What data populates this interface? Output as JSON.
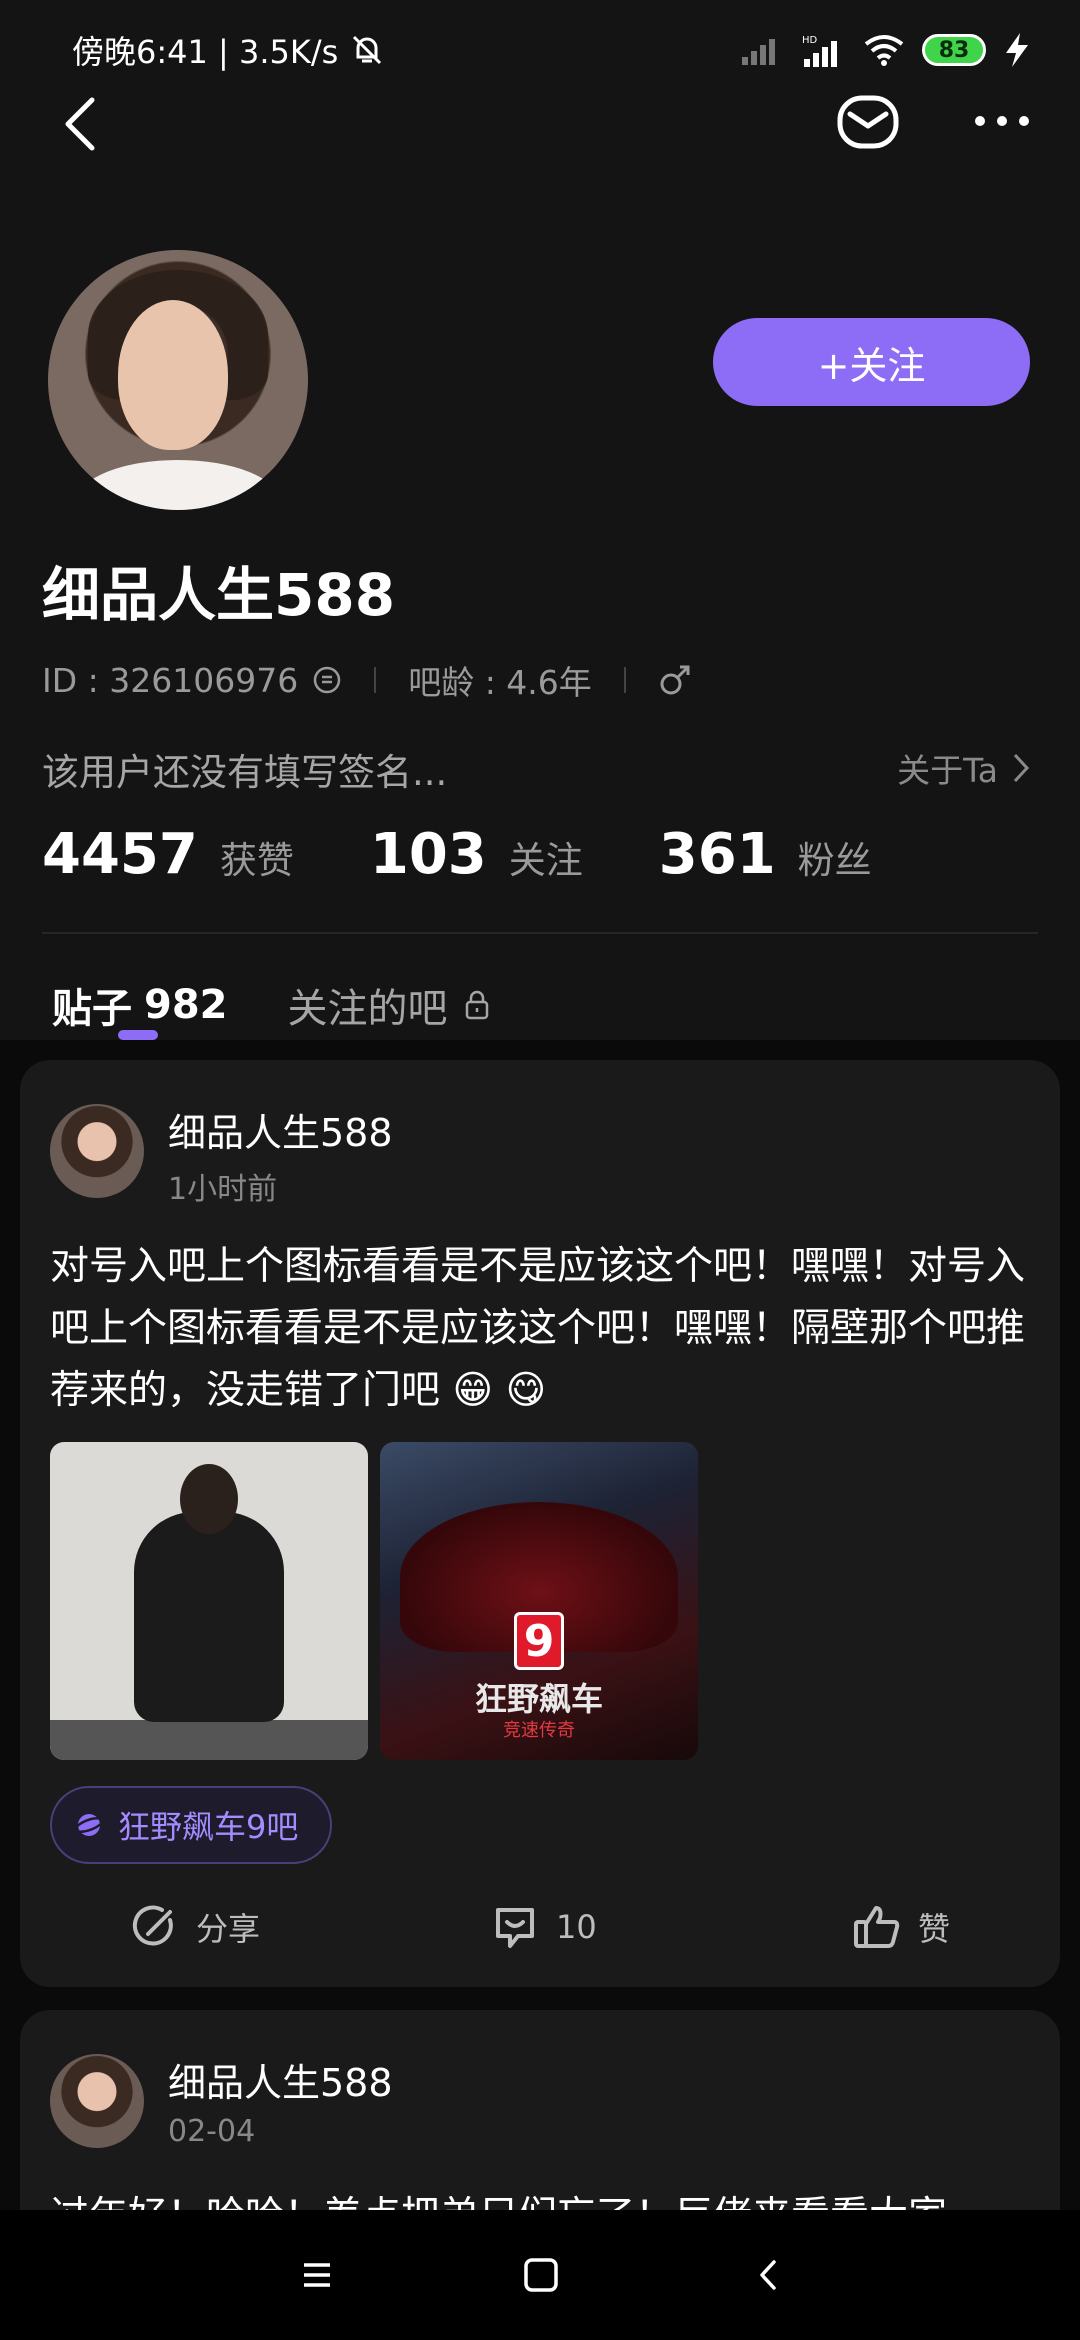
{
  "status_bar": {
    "time_speed": "傍晚6:41 | 3.5K/s",
    "battery": "83"
  },
  "profile": {
    "follow_label": "+关注",
    "username": "细品人生588",
    "id_label": "ID : 326106976",
    "age_label": "吧龄 : 4.6年",
    "signature": "该用户还没有填写签名...",
    "about_label": "关于Ta",
    "stats": [
      {
        "value": "4457",
        "label": "获赞"
      },
      {
        "value": "103",
        "label": "关注"
      },
      {
        "value": "361",
        "label": "粉丝"
      }
    ]
  },
  "tabs": {
    "posts_label": "贴子",
    "posts_count": "982",
    "followed_bars_label": "关注的吧"
  },
  "posts": [
    {
      "author": "细品人生588",
      "time": "1小时前",
      "text": "对号入吧上个图标看看是不是应该这个吧！嘿嘿！对号入吧上个图标看看是不是应该这个吧！嘿嘿！隔壁那个吧推荐来的，没走错了门吧 😁 😋",
      "image2_title": "狂野飙车",
      "image2_subtitle": "竞速传奇",
      "image2_badge": "9",
      "forum_tag": "狂野飙车9吧",
      "share_label": "分享",
      "comment_count": "10",
      "like_label": "赞"
    },
    {
      "author": "细品人生588",
      "time": "02-04",
      "text": "过年好！哈哈！差点把弟兄们忘了！巨佬来看看大家"
    }
  ],
  "colors": {
    "accent": "#8d6cf6",
    "background": "#141414",
    "card": "#1a1a1a"
  }
}
